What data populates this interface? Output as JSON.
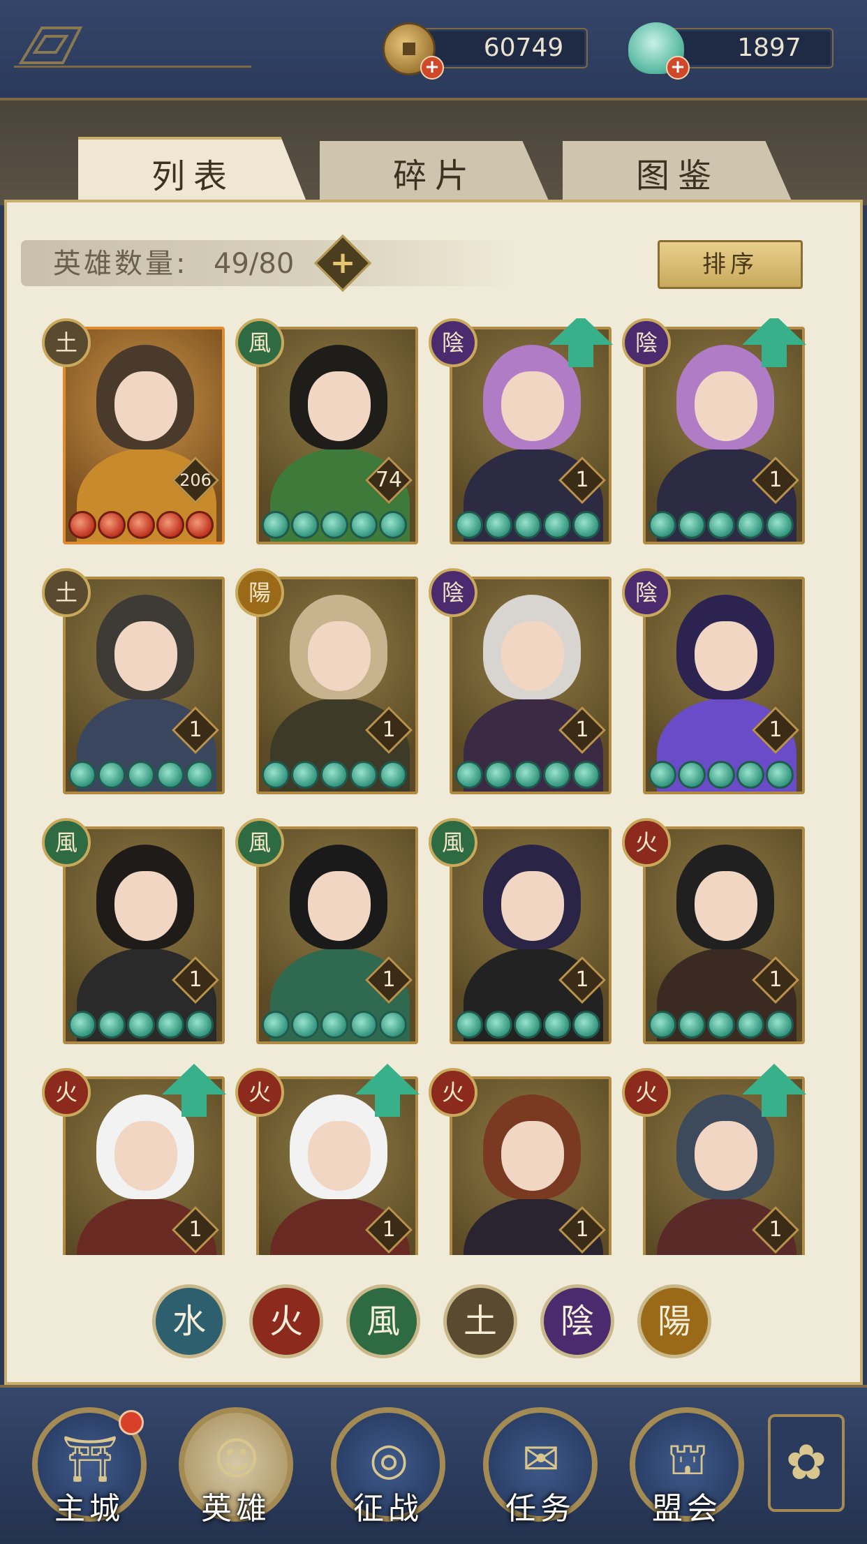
{
  "resources": {
    "coins": "60749",
    "shells": "1897"
  },
  "tabs": [
    {
      "label": "列表",
      "active": true
    },
    {
      "label": "碎片",
      "active": false
    },
    {
      "label": "图鉴",
      "active": false
    }
  ],
  "hero_count": {
    "label": "英雄数量:",
    "value": "49/80"
  },
  "sort_button": "排序",
  "heroes": [
    {
      "element": "土",
      "level": "206",
      "stars": 5,
      "star_color": "red",
      "upgrade": false,
      "frame": "gold"
    },
    {
      "element": "風",
      "level": "74",
      "stars": 5,
      "star_color": "green",
      "upgrade": false,
      "frame": "normal"
    },
    {
      "element": "陰",
      "level": "1",
      "stars": 5,
      "star_color": "green",
      "upgrade": true,
      "frame": "normal"
    },
    {
      "element": "陰",
      "level": "1",
      "stars": 5,
      "star_color": "green",
      "upgrade": true,
      "frame": "normal"
    },
    {
      "element": "土",
      "level": "1",
      "stars": 5,
      "star_color": "green",
      "upgrade": false,
      "frame": "normal"
    },
    {
      "element": "陽",
      "level": "1",
      "stars": 5,
      "star_color": "green",
      "upgrade": false,
      "frame": "normal"
    },
    {
      "element": "陰",
      "level": "1",
      "stars": 5,
      "star_color": "green",
      "upgrade": false,
      "frame": "normal"
    },
    {
      "element": "陰",
      "level": "1",
      "stars": 5,
      "star_color": "green",
      "upgrade": false,
      "frame": "normal"
    },
    {
      "element": "風",
      "level": "1",
      "stars": 5,
      "star_color": "green",
      "upgrade": false,
      "frame": "normal"
    },
    {
      "element": "風",
      "level": "1",
      "stars": 5,
      "star_color": "green",
      "upgrade": false,
      "frame": "normal"
    },
    {
      "element": "風",
      "level": "1",
      "stars": 5,
      "star_color": "green",
      "upgrade": false,
      "frame": "normal"
    },
    {
      "element": "火",
      "level": "1",
      "stars": 5,
      "star_color": "green",
      "upgrade": false,
      "frame": "normal"
    },
    {
      "element": "火",
      "level": "1",
      "stars": 0,
      "star_color": "green",
      "upgrade": true,
      "frame": "normal"
    },
    {
      "element": "火",
      "level": "1",
      "stars": 0,
      "star_color": "green",
      "upgrade": true,
      "frame": "normal"
    },
    {
      "element": "火",
      "level": "1",
      "stars": 0,
      "star_color": "green",
      "upgrade": false,
      "frame": "normal"
    },
    {
      "element": "火",
      "level": "1",
      "stars": 0,
      "star_color": "green",
      "upgrade": true,
      "frame": "normal"
    }
  ],
  "element_colors": {
    "水": "#2e5f6e",
    "火": "#8b2a1d",
    "風": "#2f6b42",
    "土": "#5a4a30",
    "陰": "#4c2a6e",
    "陽": "#9a6a18"
  },
  "element_filters": [
    "水",
    "火",
    "風",
    "土",
    "陰",
    "陽"
  ],
  "bottom_nav": [
    {
      "label": "主城",
      "icon": "castle-icon",
      "notification": true
    },
    {
      "label": "英雄",
      "icon": "hero-portrait-icon",
      "notification": false,
      "active": true
    },
    {
      "label": "征战",
      "icon": "drum-icon",
      "notification": false
    },
    {
      "label": "任务",
      "icon": "scroll-icon",
      "notification": false
    },
    {
      "label": "盟会",
      "icon": "gate-icon",
      "notification": false
    }
  ]
}
